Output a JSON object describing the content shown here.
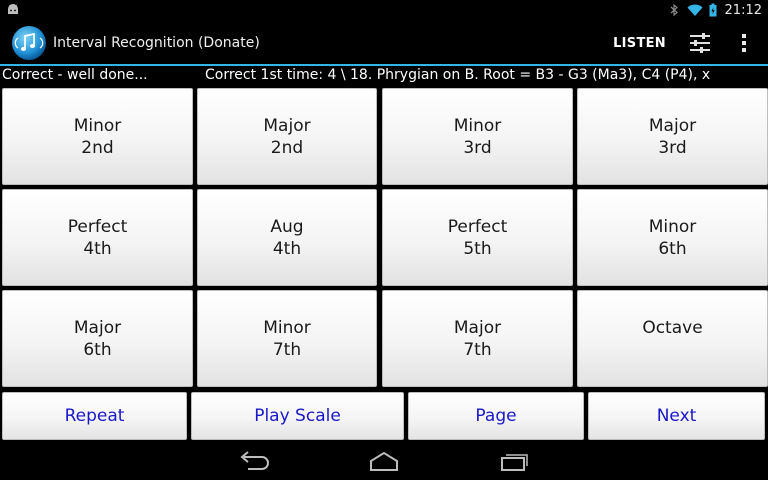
{
  "app": {
    "title": "Interval Recognition (Donate)",
    "listen_label": "LISTEN"
  },
  "status_bar": {
    "time": "21:12"
  },
  "info": {
    "status": "Correct - well done...",
    "detail": "Correct 1st time: 4 \\ 18.  Phrygian on B.  Root = B3 - G3 (Ma3), C4 (P4), x"
  },
  "intervals": [
    {
      "line1": "Minor",
      "line2": "2nd"
    },
    {
      "line1": "Major",
      "line2": "2nd"
    },
    {
      "line1": "Minor",
      "line2": "3rd"
    },
    {
      "line1": "Major",
      "line2": "3rd"
    },
    {
      "line1": "Perfect",
      "line2": "4th"
    },
    {
      "line1": "Aug",
      "line2": "4th"
    },
    {
      "line1": "Perfect",
      "line2": "5th"
    },
    {
      "line1": "Minor",
      "line2": "6th"
    },
    {
      "line1": "Major",
      "line2": "6th"
    },
    {
      "line1": "Minor",
      "line2": "7th"
    },
    {
      "line1": "Major",
      "line2": "7th"
    },
    {
      "line1": "Octave",
      "line2": ""
    }
  ],
  "buttons": {
    "repeat": "Repeat",
    "play_scale": "Play Scale",
    "page": "Page",
    "next": "Next"
  },
  "colors": {
    "accent": "#33b5e5",
    "button_text": "#1818c8"
  }
}
